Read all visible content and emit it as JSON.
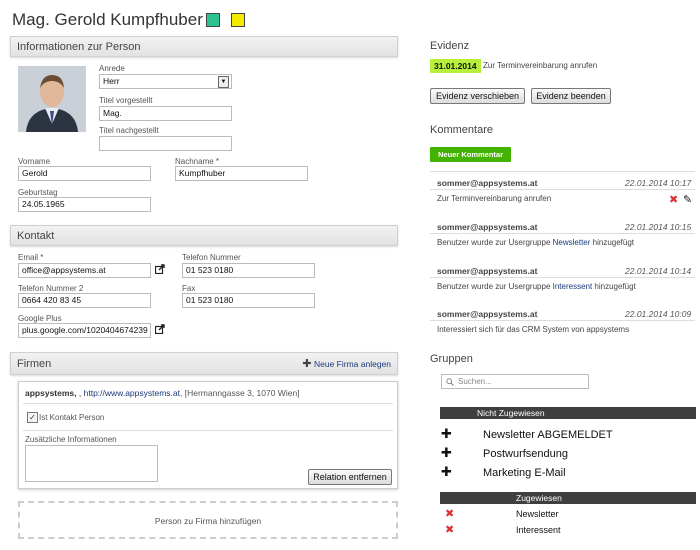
{
  "person": {
    "name": "Mag. Gerold Kumpfhuber",
    "tag_colors": [
      "#2fc18f",
      "#f4ec00"
    ]
  },
  "info_panel": {
    "title": "Informationen zur Person",
    "anrede": {
      "label": "Anrede",
      "value": "Herr"
    },
    "titel_vor": {
      "label": "Titel vorgestellt",
      "value": "Mag."
    },
    "titel_nach": {
      "label": "Titel nachgestellt",
      "value": ""
    },
    "vorname": {
      "label": "Vorname",
      "value": "Gerold"
    },
    "nachname": {
      "label": "Nachname *",
      "value": "Kumpfhuber"
    },
    "geburtstag": {
      "label": "Geburtstag",
      "value": "24.05.1965"
    }
  },
  "kontakt_panel": {
    "title": "Kontakt",
    "email": {
      "label": "Email *",
      "value": "office@appsystems.at"
    },
    "telefon": {
      "label": "Telefon Nummer",
      "value": "01 523 0180"
    },
    "telefon2": {
      "label": "Telefon Nummer 2",
      "value": "0664 420 83 45"
    },
    "fax": {
      "label": "Fax",
      "value": "01 523 0180"
    },
    "gplus": {
      "label": "Google Plus",
      "value": "plus.google.com/1020404674239"
    }
  },
  "firmen_panel": {
    "title": "Firmen",
    "add_label": "Neue Firma anlegen",
    "firma_name": "appsystems,",
    "firma_sep": ",",
    "firma_url": "http://www.appsystems.at",
    "firma_address": ", [Hermanngasse 3, 1070 Wien]",
    "kontakt_person_label": "Ist Kontakt Person",
    "zusatz_label": "Zusätzliche Informationen",
    "relation_button": "Relation entfernen",
    "add_person_label": "Person zu Firma hinzufügen"
  },
  "evidenz": {
    "title": "Evidenz",
    "date": "31.01.2014",
    "text": "Zur Terminvereinbarung anrufen",
    "btn_move": "Evidenz verschieben",
    "btn_end": "Evidenz beenden"
  },
  "kommentare": {
    "title": "Kommentare",
    "new_button": "Neuer Kommentar",
    "items": [
      {
        "author": "sommer@appsystems.at",
        "date": "22.01.2014 10:17",
        "text": "Zur Terminvereinbarung anrufen"
      },
      {
        "author": "sommer@appsystems.at",
        "date": "22.01.2014 10:15",
        "text_pre": "Benutzer wurde zur Usergruppe ",
        "text_link": "Newsletter",
        "text_post": " hinzugefügt"
      },
      {
        "author": "sommer@appsystems.at",
        "date": "22.01.2014 10:14",
        "text_pre": "Benutzer wurde zur Usergruppe ",
        "text_link": "Interessent",
        "text_post": " hinzugefügt"
      },
      {
        "author": "sommer@appsystems.at",
        "date": "22.01.2014 10:09",
        "text": "Interessiert sich für das CRM System von appsystems"
      }
    ]
  },
  "gruppen": {
    "title": "Gruppen",
    "search_placeholder": "Suchen...",
    "not_assigned_header": "Nicht Zugewiesen",
    "not_assigned": [
      "Newsletter ABGEMELDET",
      "Postwurfsendung",
      "Marketing E-Mail"
    ],
    "assigned_header": "Zugewiesen",
    "assigned": [
      "Newsletter",
      "Interessent"
    ]
  },
  "colors": {
    "accent_green": "#44b300",
    "date_highlight": "#b7f03a",
    "link": "#1a3a7a"
  }
}
